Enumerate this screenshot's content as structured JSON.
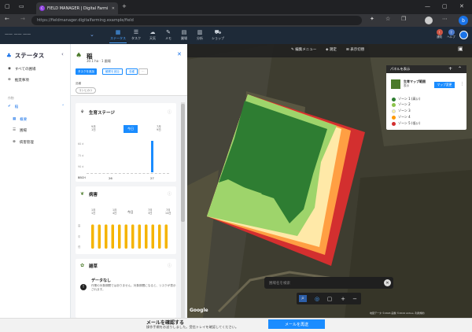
{
  "browser": {
    "tab_title": "FIELD MANAGER | Digital Farmi",
    "tab_favicon_letter": "C",
    "url": "https://fieldmanager.digitalfarming.example/field"
  },
  "header": {
    "org": "—— —— ——",
    "nav": [
      {
        "label": "ステータス",
        "icon": "▦",
        "active": true
      },
      {
        "label": "タスク",
        "icon": "☰"
      },
      {
        "label": "天気",
        "icon": "☁"
      },
      {
        "label": "メモ",
        "icon": "✎"
      },
      {
        "label": "圃場",
        "icon": "▤"
      },
      {
        "label": "分析",
        "icon": "▥"
      },
      {
        "label": "ショップ",
        "icon": "⛟"
      }
    ],
    "right": [
      {
        "label": "通知",
        "icon": "!"
      },
      {
        "label": "ヘルプ",
        "icon": "?"
      }
    ]
  },
  "sidebar": {
    "title": "ステータス",
    "items_top": [
      {
        "label": "すべての圃場",
        "icon": "◉"
      },
      {
        "label": "推奨事項",
        "icon": "⊛"
      }
    ],
    "section": "作物",
    "crop": {
      "label": "稲",
      "icon": "✔"
    },
    "items_sub": [
      {
        "label": "概要",
        "icon": "▦",
        "active": true
      },
      {
        "label": "圃場",
        "icon": "☰"
      },
      {
        "label": "病害管理",
        "icon": "⊗"
      }
    ]
  },
  "panel": {
    "title": "稲",
    "subtitle": "30.1 ha ‧ 1 圃場",
    "buttons": [
      "タスクを追加",
      "観察を追加",
      "収穫",
      "⋯"
    ],
    "label": "品種",
    "tag": "コシヒカリ",
    "growth": {
      "title": "生育ステージ",
      "dates": [
        {
          "top": "9月",
          "bottom": "1日"
        },
        {
          "top": "",
          "bottom": "今日"
        },
        {
          "top": "7月",
          "bottom": "9日"
        }
      ],
      "axis": [
        "60 d",
        "75 d",
        "90 d"
      ],
      "footer": [
        "BBCH",
        "26",
        "27"
      ]
    },
    "disease": {
      "title": "病害",
      "today": "今日",
      "dates": [
        {
          "top": "1月",
          "bottom": "1日"
        },
        {
          "top": "1月",
          "bottom": "4日"
        },
        {
          "top": "7月",
          "bottom": "3日"
        },
        {
          "top": "7月",
          "bottom": "14日"
        }
      ],
      "axis": [
        "高",
        "中",
        "低"
      ],
      "bars": [
        0.9,
        0.9,
        0.9,
        0.9,
        0.9,
        0.9,
        0.9,
        0.9,
        0.9,
        0.9,
        0.9,
        0.9
      ]
    },
    "weeds": {
      "title": "雑草",
      "nodata": "データなし",
      "msg": "作業の対象期間ではありません。対象期間になると、リスクが表示されます。"
    }
  },
  "map": {
    "toolbar": [
      {
        "label": "編集メニュー",
        "icon": "✎"
      },
      {
        "label": "測定",
        "icon": "◈"
      },
      {
        "label": "表示切替",
        "icon": "⊞"
      }
    ],
    "legend": {
      "title": "パネルを表示",
      "layer_title": "生育マップ範囲",
      "layer_sub": "表示",
      "button": "マップ変更",
      "zones": [
        {
          "label": "ゾーン 1 (高い)",
          "color": "#2e7d32"
        },
        {
          "label": "ゾーン 2",
          "color": "#8bc34a"
        },
        {
          "label": "ゾーン 3",
          "color": "#fff59d"
        },
        {
          "label": "ゾーン 4",
          "color": "#ff9800"
        },
        {
          "label": "ゾーン 5 (低い)",
          "color": "#d32f2f"
        }
      ]
    },
    "search_placeholder": "圃場名を検索",
    "google": "Google",
    "attribution": "地図データ ©2024 画像 ©2024 Airbus, 利用規約"
  },
  "bottom": {
    "title": "メールを確認する",
    "desc": "操作手順をお送りしました。受信トレイを確認してください。",
    "button": "メールを再送"
  }
}
